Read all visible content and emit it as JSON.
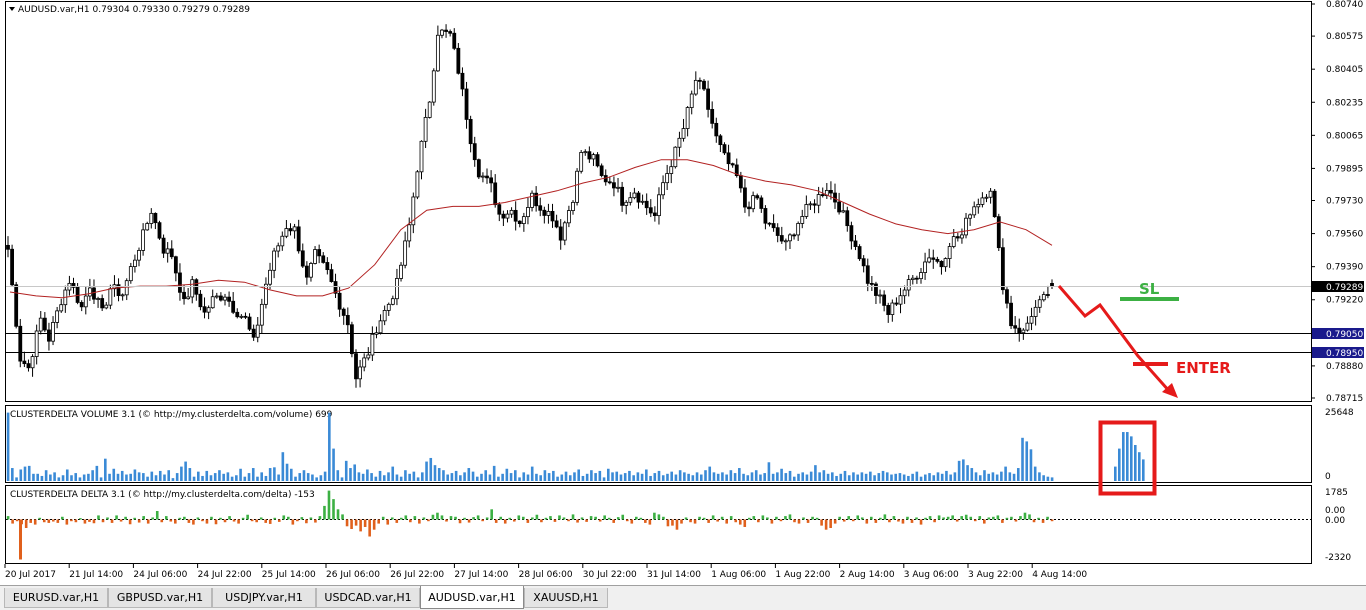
{
  "symbol_info": "AUDUSD.var,H1  0.79304 0.79330 0.79279 0.79289",
  "price_axis": {
    "ticks": [
      "0.80740",
      "0.80575",
      "0.80405",
      "0.80235",
      "0.80065",
      "0.79895",
      "0.79730",
      "0.79560",
      "0.79390",
      "0.79220",
      "0.79050",
      "0.78880",
      "0.78715"
    ],
    "current_price": "0.79289",
    "lines": [
      {
        "price": 0.7905,
        "label": "0.79050"
      },
      {
        "price": 0.7895,
        "label": "0.78950"
      }
    ],
    "price_min": 0.78715,
    "price_max": 0.8074
  },
  "volume_panel": {
    "title": "CLUSTERDELTA VOLUME 3.1 (© http://my.clusterdelta.com/volume) 699",
    "axis_top": "25648",
    "axis_bottom": "0"
  },
  "delta_panel": {
    "title": "CLUSTERDELTA DELTA 3.1 (© http://my.clusterdelta.com/delta) -153",
    "ticks": [
      "1785",
      "0.00",
      "0.00",
      "-2320"
    ]
  },
  "time_axis": [
    "20 Jul 2017",
    "21 Jul 14:00",
    "24 Jul 06:00",
    "24 Jul 22:00",
    "25 Jul 14:00",
    "26 Jul 06:00",
    "26 Jul 22:00",
    "27 Jul 14:00",
    "28 Jul 06:00",
    "30 Jul 22:00",
    "31 Jul 14:00",
    "1 Aug 06:00",
    "1 Aug 22:00",
    "2 Aug 14:00",
    "3 Aug 06:00",
    "3 Aug 22:00",
    "4 Aug 14:00"
  ],
  "annotations": {
    "sl": "SL",
    "enter": "ENTER"
  },
  "tabs": [
    "EURUSD.var,H1",
    "GBPUSD.var,H1",
    "USDJPY.var,H1",
    "USDCAD.var,H1",
    "AUDUSD.var,H1",
    "XAUUSD,H1"
  ],
  "active_tab": 4,
  "colors": {
    "candle": "#000000",
    "moving_average": "#b22222",
    "volume_bar": "#3a8ad6",
    "delta_positive": "#3cb043",
    "delta_negative": "#e0601c",
    "annotation_red": "#e51a1a",
    "sl_green": "#3cb043",
    "price_label_bg": "#000000",
    "line_label_bg": "#1a1a8c"
  },
  "chart_data": {
    "type": "candlestick",
    "symbol": "AUDUSD.var",
    "timeframe": "H1",
    "ohlc_last": {
      "open": 0.79304,
      "high": 0.7933,
      "low": 0.79279,
      "close": 0.79289
    },
    "path_points": [
      [
        0.7956,
        0.7948
      ],
      [
        0.7892,
        0.7887
      ],
      [
        0.7912,
        0.7902
      ],
      [
        0.7922,
        0.7932
      ],
      [
        0.7918,
        0.793
      ],
      [
        0.7915,
        0.7928
      ],
      [
        0.7925,
        0.7938
      ],
      [
        0.7955,
        0.7968
      ],
      [
        0.7948,
        0.7945
      ],
      [
        0.792,
        0.793
      ],
      [
        0.7915,
        0.7922
      ],
      [
        0.7925,
        0.7918
      ],
      [
        0.7912,
        0.79
      ],
      [
        0.793,
        0.7945
      ],
      [
        0.796,
        0.7958
      ],
      [
        0.7932,
        0.7945
      ],
      [
        0.7936,
        0.7925
      ],
      [
        0.791,
        0.7882
      ],
      [
        0.7895,
        0.7908
      ],
      [
        0.792,
        0.793
      ],
      [
        0.796,
        0.799
      ],
      [
        0.8025,
        0.806
      ],
      [
        0.8058,
        0.804
      ],
      [
        0.8005,
        0.7988
      ],
      [
        0.798,
        0.7966
      ],
      [
        0.7968,
        0.7962
      ],
      [
        0.7975,
        0.797
      ],
      [
        0.7965,
        0.7955
      ],
      [
        0.7975,
        0.7998
      ],
      [
        0.7994,
        0.7985
      ],
      [
        0.7982,
        0.7973
      ],
      [
        0.7978,
        0.7972
      ],
      [
        0.7965,
        0.7982
      ],
      [
        0.7998,
        0.801
      ],
      [
        0.8035,
        0.8028
      ],
      [
        0.8005,
        0.7995
      ],
      [
        0.7985,
        0.797
      ],
      [
        0.7974,
        0.7962
      ],
      [
        0.7955,
        0.795
      ],
      [
        0.7962,
        0.7968
      ],
      [
        0.7975,
        0.798
      ],
      [
        0.797,
        0.796
      ],
      [
        0.7945,
        0.7932
      ],
      [
        0.7922,
        0.7915
      ],
      [
        0.7925,
        0.793
      ],
      [
        0.7938,
        0.7945
      ],
      [
        0.794,
        0.7952
      ],
      [
        0.7955,
        0.7968
      ],
      [
        0.7975,
        0.798
      ],
      [
        0.793,
        0.791
      ],
      [
        0.7905,
        0.7915
      ],
      [
        0.7922,
        0.7928
      ]
    ],
    "ma_points": [
      0.7926,
      0.7924,
      0.7923,
      0.7925,
      0.7928,
      0.7929,
      0.7929,
      0.793,
      0.7932,
      0.7931,
      0.7927,
      0.7924,
      0.7924,
      0.7928,
      0.794,
      0.7958,
      0.7968,
      0.797,
      0.797,
      0.7972,
      0.7975,
      0.7978,
      0.7982,
      0.7985,
      0.799,
      0.7994,
      0.7994,
      0.7991,
      0.7986,
      0.7983,
      0.7981,
      0.7978,
      0.7972,
      0.7966,
      0.7961,
      0.7958,
      0.7956,
      0.7958,
      0.7962,
      0.7958,
      0.795
    ],
    "volume_values": [
      0.95,
      0.18,
      0.05,
      0.16,
      0.2,
      0.21,
      0.1,
      0.1,
      0.07,
      0.15,
      0.09,
      0.12,
      0.05,
      0.08,
      0.16,
      0.08,
      0.11,
      0.05,
      0.09,
      0.1,
      0.15,
      0.21,
      0.05,
      0.31,
      0.1,
      0.17,
      0.1,
      0.14,
      0.09,
      0.1,
      0.16,
      0.12,
      0.11,
      0.06,
      0.13,
      0.08,
      0.14,
      0.09,
      0.15,
      0.04,
      0.11,
      0.2,
      0.27,
      0.18,
      0.06,
      0.13,
      0.07,
      0.14,
      0.08,
      0.11,
      0.15,
      0.1,
      0.12,
      0.06,
      0.08,
      0.17,
      0.06,
      0.11,
      0.18,
      0.06,
      0.12,
      0.07,
      0.18,
      0.19,
      0.09,
      0.4,
      0.24,
      0.17,
      0.06,
      0.11,
      0.15,
      0.11,
      0.09,
      0.05,
      0.08,
      0.13,
      0.95,
      0.45,
      0.15,
      0.05,
      0.28,
      0.18,
      0.23,
      0.12,
      0.1,
      0.16,
      0.11,
      0.06,
      0.14,
      0.08,
      0.12,
      0.2,
      0.09,
      0.06,
      0.15,
      0.1,
      0.13,
      0.05,
      0.12,
      0.27,
      0.32,
      0.22,
      0.18,
      0.15,
      0.09,
      0.11,
      0.14,
      0.08,
      0.12,
      0.18,
      0.13,
      0.06,
      0.1,
      0.15,
      0.09,
      0.21,
      0.06,
      0.1,
      0.17,
      0.11,
      0.15,
      0.05,
      0.12,
      0.09,
      0.2,
      0.1,
      0.08,
      0.15,
      0.11,
      0.14,
      0.06,
      0.09,
      0.13,
      0.08,
      0.12,
      0.16,
      0.07,
      0.1,
      0.15,
      0.11,
      0.14,
      0.05,
      0.17,
      0.12,
      0.13,
      0.09,
      0.11,
      0.14,
      0.08,
      0.12,
      0.1,
      0.16,
      0.07,
      0.11,
      0.14,
      0.08,
      0.1,
      0.13,
      0.09,
      0.15,
      0.12,
      0.1,
      0.08,
      0.12,
      0.09,
      0.15,
      0.2,
      0.12,
      0.1,
      0.12,
      0.09,
      0.15,
      0.11,
      0.18,
      0.1,
      0.08,
      0.12,
      0.15,
      0.09,
      0.11,
      0.26,
      0.1,
      0.12,
      0.17,
      0.11,
      0.14,
      0.06,
      0.1,
      0.12,
      0.09,
      0.13,
      0.22,
      0.12,
      0.15,
      0.1,
      0.12,
      0.07,
      0.1,
      0.14,
      0.08,
      0.12,
      0.09,
      0.12,
      0.1,
      0.13,
      0.08,
      0.11,
      0.14,
      0.12,
      0.09,
      0.1,
      0.11,
      0.09,
      0.07,
      0.1,
      0.13,
      0.06,
      0.09,
      0.11,
      0.08,
      0.12,
      0.1,
      0.14,
      0.09,
      0.12,
      0.28,
      0.3,
      0.22,
      0.18,
      0.12,
      0.08,
      0.15,
      0.1,
      0.12,
      0.09,
      0.13,
      0.2,
      0.12,
      0.1,
      0.18,
      0.6,
      0.55,
      0.44,
      0.2,
      0.12,
      0.08,
      0.06,
      0.05
    ],
    "delta_values": [
      0.1,
      -0.12,
      -0.05,
      -0.14,
      -0.25,
      -0.1,
      -0.15,
      0.05,
      -0.08,
      -0.1,
      -0.06,
      -0.1,
      0.08,
      -0.15,
      -0.05,
      -0.08,
      0.04,
      -0.12,
      -0.07,
      -0.11,
      0.12,
      -0.08,
      0.06,
      -0.1,
      0.12,
      -0.06,
      0.08,
      -0.14,
      0.05,
      -0.09,
      0.1,
      -0.12,
      0.06,
      0.25,
      -0.08,
      0.1,
      -0.06,
      -0.12,
      0.05,
      0.08,
      -0.1,
      -0.15,
      0.06,
      -0.05,
      -0.12,
      0.08,
      -0.14,
      0.05,
      -0.08,
      0.1,
      -0.06,
      -0.12,
      0.05,
      0.14,
      -0.05,
      -0.08,
      0.06,
      -0.1,
      -0.13,
      0.05,
      -0.07,
      0.12,
      0.08,
      -0.15,
      -0.05,
      0.07,
      -0.11,
      0.06,
      -0.09,
      0.1,
      0.4,
      0.85,
      0.6,
      0.3,
      0.15,
      -0.2,
      -0.28,
      -0.18,
      -0.35,
      -0.22,
      -0.5,
      -0.3,
      -0.12,
      0.08,
      -0.15,
      0.06,
      -0.1,
      0.05,
      0.12,
      -0.08,
      0.1,
      -0.12,
      0.06,
      -0.05,
      0.14,
      0.2,
      0.12,
      -0.06,
      0.1,
      0.08,
      -0.11,
      0.05,
      -0.09,
      0.07,
      0.12,
      -0.05,
      0.06,
      0.3,
      -0.1,
      0.08,
      -0.12,
      0.05,
      -0.06,
      0.12,
      0.08,
      -0.1,
      0.06,
      0.14,
      -0.08,
      0.05,
      0.1,
      -0.07,
      0.12,
      0.06,
      -0.05,
      0.15,
      -0.09,
      0.06,
      -0.07,
      0.1,
      0.08,
      -0.06,
      0.12,
      0.05,
      -0.1,
      0.07,
      0.14,
      -0.05,
      -0.12,
      0.08,
      0.05,
      -0.1,
      -0.15,
      0.2,
      0.15,
      0.08,
      -0.2,
      -0.18,
      -0.3,
      -0.12,
      0.06,
      -0.08,
      -0.12,
      0.08,
      0.05,
      -0.1,
      0.12,
      -0.06,
      0.08,
      -0.12,
      0.1,
      -0.08,
      -0.15,
      -0.22,
      0.05,
      0.1,
      -0.08,
      0.12,
      0.06,
      -0.12,
      0.08,
      -0.05,
      0.1,
      0.15,
      -0.08,
      -0.12,
      0.06,
      -0.1,
      0.08,
      0.05,
      -0.18,
      -0.3,
      -0.25,
      -0.12,
      0.08,
      -0.06,
      0.1,
      -0.05,
      0.12,
      0.06,
      -0.12,
      0.08,
      -0.1,
      0.05,
      0.15,
      -0.08,
      0.1,
      -0.06,
      -0.12,
      0.08,
      -0.1,
      0.06,
      -0.15,
      0.05,
      0.1,
      -0.08,
      0.12,
      0.06,
      0.08,
      0.12,
      -0.06,
      0.1,
      0.14,
      0.08,
      -0.05,
      0.1,
      -0.12,
      0.06,
      0.08,
      0.12,
      -0.1,
      0.05,
      0.08,
      -0.06,
      0.1,
      0.2,
      0.15,
      -0.08,
      0.05,
      -0.1,
      0.08,
      -0.05
    ]
  }
}
